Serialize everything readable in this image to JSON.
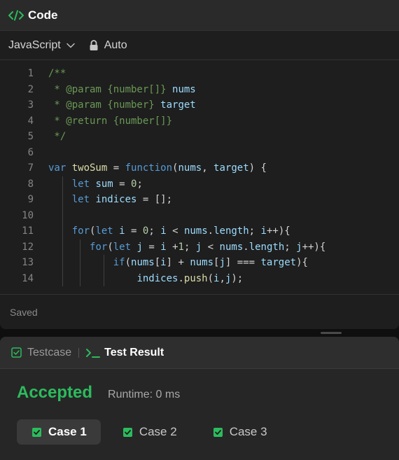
{
  "code_panel": {
    "title": "Code",
    "language": "JavaScript",
    "mode": "Auto",
    "status": "Saved"
  },
  "editor": {
    "lines": [
      {
        "n": "1",
        "tokens": [
          {
            "t": "/**",
            "c": "comment"
          }
        ]
      },
      {
        "n": "2",
        "tokens": [
          {
            "t": " * @param {number[]} ",
            "c": "comment"
          },
          {
            "t": "nums",
            "c": "ident"
          }
        ]
      },
      {
        "n": "3",
        "tokens": [
          {
            "t": " * @param {number} ",
            "c": "comment"
          },
          {
            "t": "target",
            "c": "ident"
          }
        ]
      },
      {
        "n": "4",
        "tokens": [
          {
            "t": " * @return {number[]}",
            "c": "comment"
          }
        ]
      },
      {
        "n": "5",
        "tokens": [
          {
            "t": " */",
            "c": "comment"
          }
        ]
      },
      {
        "n": "6",
        "tokens": []
      },
      {
        "n": "7",
        "tokens": [
          {
            "t": "var ",
            "c": "keyword"
          },
          {
            "t": "twoSum",
            "c": "fn"
          },
          {
            "t": " = ",
            "c": "op"
          },
          {
            "t": "function",
            "c": "keyword"
          },
          {
            "t": "(",
            "c": "op"
          },
          {
            "t": "nums",
            "c": "ident"
          },
          {
            "t": ", ",
            "c": "op"
          },
          {
            "t": "target",
            "c": "ident"
          },
          {
            "t": ") {",
            "c": "op"
          }
        ]
      },
      {
        "n": "8",
        "tokens": [
          {
            "t": "    ",
            "c": "op"
          },
          {
            "t": "let ",
            "c": "keyword"
          },
          {
            "t": "sum",
            "c": "ident"
          },
          {
            "t": " = ",
            "c": "op"
          },
          {
            "t": "0",
            "c": "num"
          },
          {
            "t": ";",
            "c": "op"
          }
        ]
      },
      {
        "n": "9",
        "tokens": [
          {
            "t": "    ",
            "c": "op"
          },
          {
            "t": "let ",
            "c": "keyword"
          },
          {
            "t": "indices",
            "c": "ident"
          },
          {
            "t": " = [];",
            "c": "op"
          }
        ]
      },
      {
        "n": "10",
        "tokens": []
      },
      {
        "n": "11",
        "tokens": [
          {
            "t": "    ",
            "c": "op"
          },
          {
            "t": "for",
            "c": "keyword"
          },
          {
            "t": "(",
            "c": "op"
          },
          {
            "t": "let ",
            "c": "keyword"
          },
          {
            "t": "i",
            "c": "ident"
          },
          {
            "t": " = ",
            "c": "op"
          },
          {
            "t": "0",
            "c": "num"
          },
          {
            "t": "; ",
            "c": "op"
          },
          {
            "t": "i",
            "c": "ident"
          },
          {
            "t": " < ",
            "c": "op"
          },
          {
            "t": "nums",
            "c": "ident"
          },
          {
            "t": ".",
            "c": "op"
          },
          {
            "t": "length",
            "c": "ident"
          },
          {
            "t": "; ",
            "c": "op"
          },
          {
            "t": "i",
            "c": "ident"
          },
          {
            "t": "++){",
            "c": "op"
          }
        ]
      },
      {
        "n": "12",
        "tokens": [
          {
            "t": "       ",
            "c": "op"
          },
          {
            "t": "for",
            "c": "keyword"
          },
          {
            "t": "(",
            "c": "op"
          },
          {
            "t": "let ",
            "c": "keyword"
          },
          {
            "t": "j",
            "c": "ident"
          },
          {
            "t": " = ",
            "c": "op"
          },
          {
            "t": "i",
            "c": "ident"
          },
          {
            "t": " +",
            "c": "op"
          },
          {
            "t": "1",
            "c": "num"
          },
          {
            "t": "; ",
            "c": "op"
          },
          {
            "t": "j",
            "c": "ident"
          },
          {
            "t": " < ",
            "c": "op"
          },
          {
            "t": "nums",
            "c": "ident"
          },
          {
            "t": ".",
            "c": "op"
          },
          {
            "t": "length",
            "c": "ident"
          },
          {
            "t": "; ",
            "c": "op"
          },
          {
            "t": "j",
            "c": "ident"
          },
          {
            "t": "++){",
            "c": "op"
          }
        ]
      },
      {
        "n": "13",
        "tokens": [
          {
            "t": "           ",
            "c": "op"
          },
          {
            "t": "if",
            "c": "keyword"
          },
          {
            "t": "(",
            "c": "op"
          },
          {
            "t": "nums",
            "c": "ident"
          },
          {
            "t": "[",
            "c": "op"
          },
          {
            "t": "i",
            "c": "ident"
          },
          {
            "t": "] + ",
            "c": "op"
          },
          {
            "t": "nums",
            "c": "ident"
          },
          {
            "t": "[",
            "c": "op"
          },
          {
            "t": "j",
            "c": "ident"
          },
          {
            "t": "] === ",
            "c": "op"
          },
          {
            "t": "target",
            "c": "ident"
          },
          {
            "t": "){",
            "c": "op"
          }
        ]
      },
      {
        "n": "14",
        "tokens": [
          {
            "t": "               ",
            "c": "op"
          },
          {
            "t": "indices",
            "c": "ident"
          },
          {
            "t": ".",
            "c": "op"
          },
          {
            "t": "push",
            "c": "fn"
          },
          {
            "t": "(",
            "c": "op"
          },
          {
            "t": "i",
            "c": "ident"
          },
          {
            "t": ",",
            "c": "op"
          },
          {
            "t": "j",
            "c": "ident"
          },
          {
            "t": ");",
            "c": "op"
          }
        ]
      }
    ]
  },
  "result_panel": {
    "tabs": [
      {
        "label": "Testcase",
        "active": false
      },
      {
        "label": "Test Result",
        "active": true
      }
    ],
    "status": "Accepted",
    "runtime": "Runtime: 0 ms",
    "cases": [
      {
        "label": "Case 1",
        "selected": true
      },
      {
        "label": "Case 2",
        "selected": false
      },
      {
        "label": "Case 3",
        "selected": false
      }
    ]
  },
  "colors": {
    "accent_green": "#2cbb5d",
    "panel_bg": "#1e1e1e",
    "header_bg": "#2a2a2a"
  }
}
